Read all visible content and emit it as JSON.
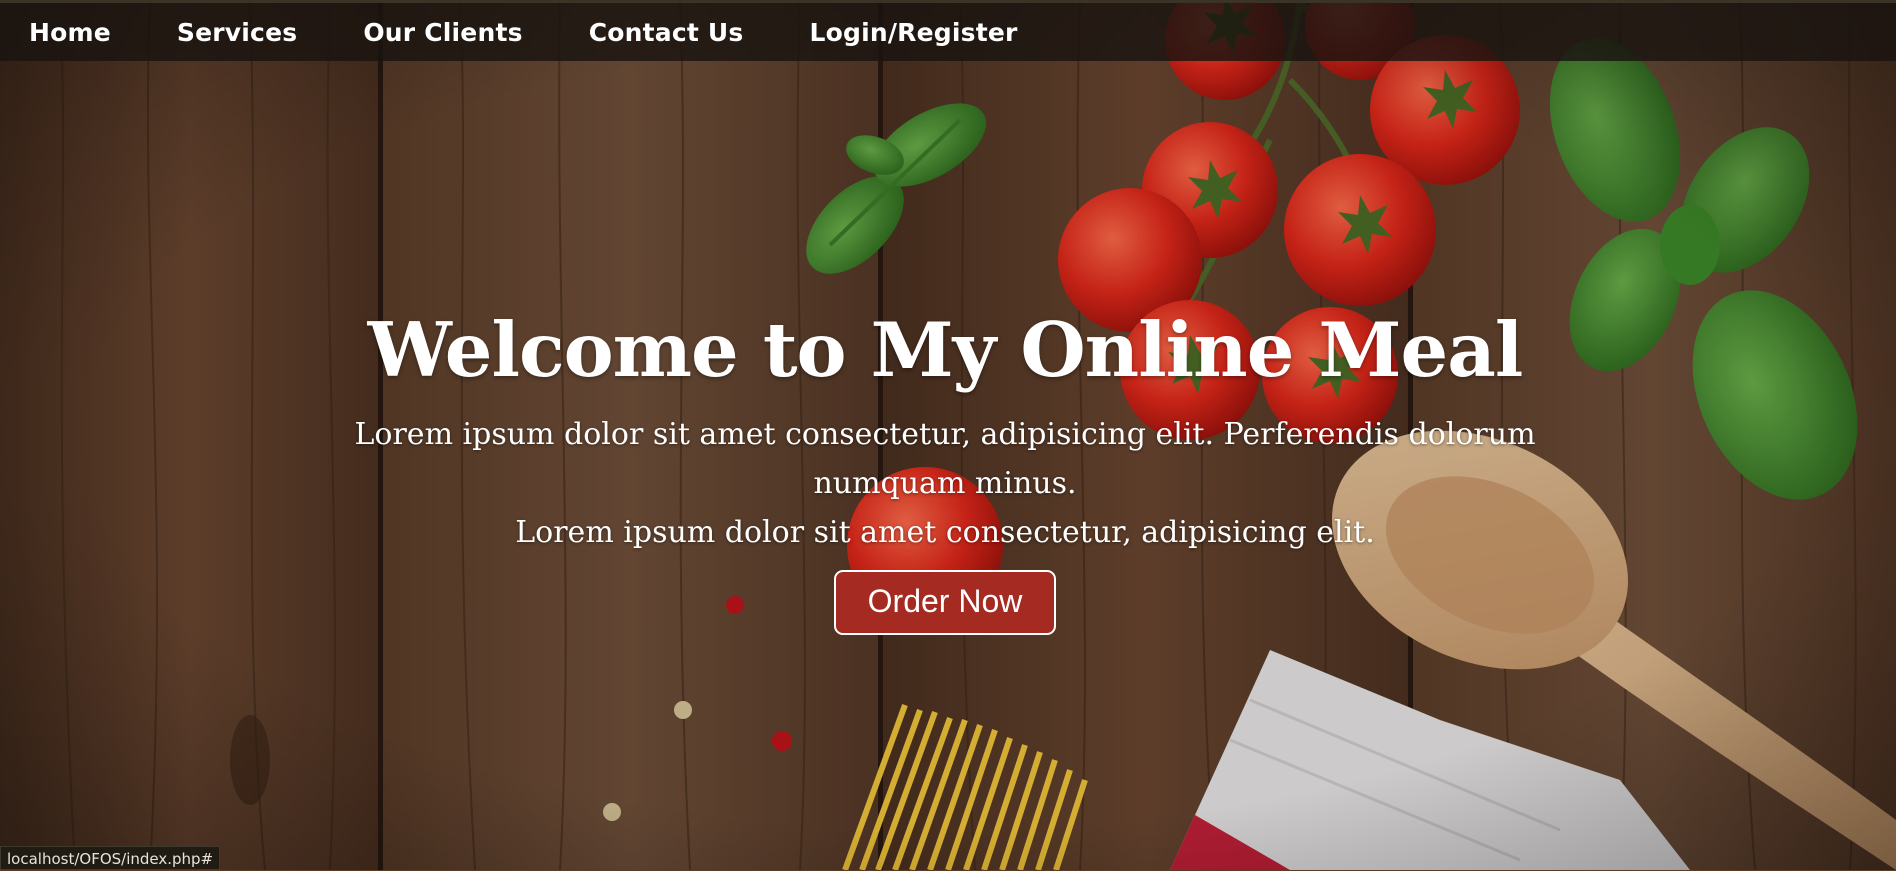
{
  "nav": {
    "items": [
      {
        "label": "Home"
      },
      {
        "label": "Services"
      },
      {
        "label": "Our Clients"
      },
      {
        "label": "Contact Us"
      },
      {
        "label": "Login/Register"
      }
    ]
  },
  "hero": {
    "title": "Welcome to My Online Meal",
    "line1": "Lorem ipsum dolor sit amet consectetur, adipisicing elit. Perferendis dolorum numquam minus.",
    "line2": "Lorem ipsum dolor sit amet consectetur, adipisicing elit.",
    "button_label": "Order Now"
  },
  "status_bar": {
    "url": "localhost/OFOS/index.php#"
  },
  "colors": {
    "navbar": "#1a1410",
    "button": "#a42a22",
    "wood": "#5a3b26"
  }
}
